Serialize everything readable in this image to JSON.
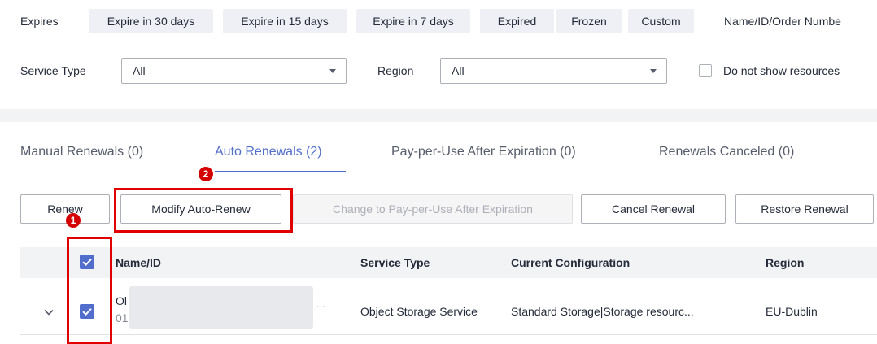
{
  "filters": {
    "expires_label": "Expires",
    "chips": [
      "Expire in 30 days",
      "Expire in 15 days",
      "Expire in 7 days",
      "Expired",
      "Frozen",
      "Custom"
    ],
    "search_label": "Name/ID/Order Numbe",
    "service_type_label": "Service Type",
    "service_type_value": "All",
    "region_label": "Region",
    "region_value": "All",
    "hide_resources_label": "Do not show resources"
  },
  "tabs": [
    {
      "label": "Manual Renewals (0)",
      "active": false
    },
    {
      "label": "Auto Renewals (2)",
      "active": true
    },
    {
      "label": "Pay-per-Use After Expiration (0)",
      "active": false
    },
    {
      "label": "Renewals Canceled (0)",
      "active": false
    }
  ],
  "toolbar": {
    "renew": "Renew",
    "modify_auto_renew": "Modify Auto-Renew",
    "change_to_ppu": "Change to Pay-per-Use After Expiration",
    "cancel_renewal": "Cancel Renewal",
    "restore_renewal": "Restore Renewal"
  },
  "table": {
    "headers": [
      "Name/ID",
      "Service Type",
      "Current Configuration",
      "Region"
    ],
    "rows": [
      {
        "name_fragment": "Ol",
        "id_fragment": "01",
        "ellipsis": "...",
        "service_type": "Object Storage Service",
        "configuration": "Standard Storage|Storage resourc...",
        "region": "EU-Dublin",
        "selected": true
      }
    ]
  },
  "callouts": [
    "1",
    "2"
  ],
  "colors": {
    "accent": "#526ecc",
    "highlight": "#e00000",
    "chip_bg": "#eef0f5",
    "header_bg": "#f2f3f5"
  },
  "icons": [
    "caret-down-icon",
    "checkbox-checked-icon",
    "chevron-down-icon"
  ]
}
